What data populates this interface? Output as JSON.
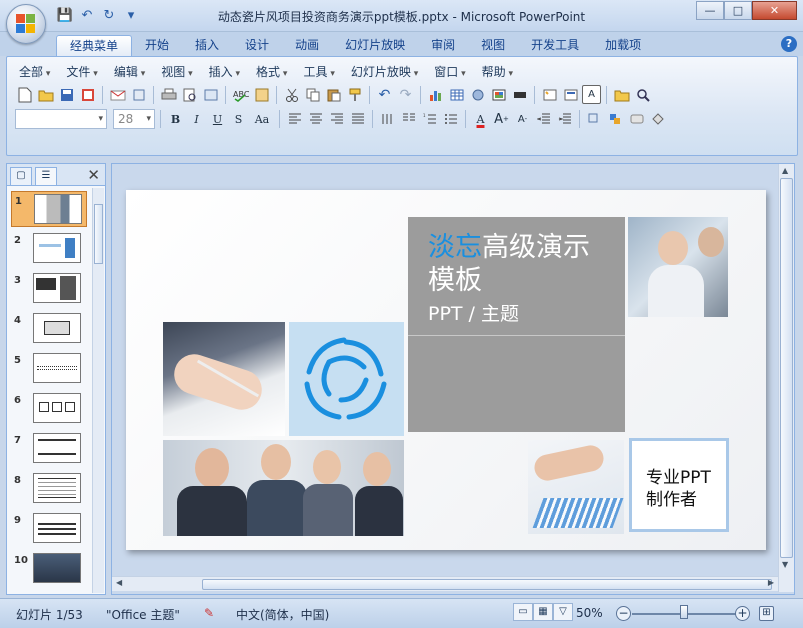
{
  "window": {
    "title": "动态瓷片风项目投资商务演示ppt模板.pptx - Microsoft PowerPoint",
    "buttons": {
      "minimize": "—",
      "maximize": "□",
      "close": "✕"
    }
  },
  "quick_access": {
    "save": "💾",
    "undo": "↶",
    "redo": "↻",
    "customize": "▾"
  },
  "ribbon_tabs": [
    "经典菜单",
    "开始",
    "插入",
    "设计",
    "动画",
    "幻灯片放映",
    "审阅",
    "视图",
    "开发工具",
    "加载项"
  ],
  "help": "?",
  "menus": [
    "全部",
    "文件",
    "编辑",
    "视图",
    "插入",
    "格式",
    "工具",
    "幻灯片放映",
    "窗口",
    "帮助"
  ],
  "font_size": "28",
  "format_buttons": {
    "bold": "B",
    "italic": "I",
    "underline": "U",
    "shadow": "S",
    "change_case": "Aa",
    "font_color": "A"
  },
  "pane": {
    "tab_slides": "▢",
    "tab_outline": "☰",
    "close": "✕",
    "slide_numbers": [
      "1",
      "2",
      "3",
      "4",
      "5",
      "6",
      "7",
      "8",
      "9",
      "10"
    ]
  },
  "slide": {
    "title_accent": "淡忘",
    "title_rest": "高级演示",
    "title_line2": "模板",
    "subtitle": "PPT /  主题",
    "maker_line1": "专业PPT",
    "maker_line2": "制作者",
    "accent_color": "#1a8fdf"
  },
  "status": {
    "slide_info": "幻灯片 1/53",
    "theme": "\"Office 主题\"",
    "language": "中文(简体，中国)",
    "zoom": "50%",
    "zoom_level": 0.5
  }
}
